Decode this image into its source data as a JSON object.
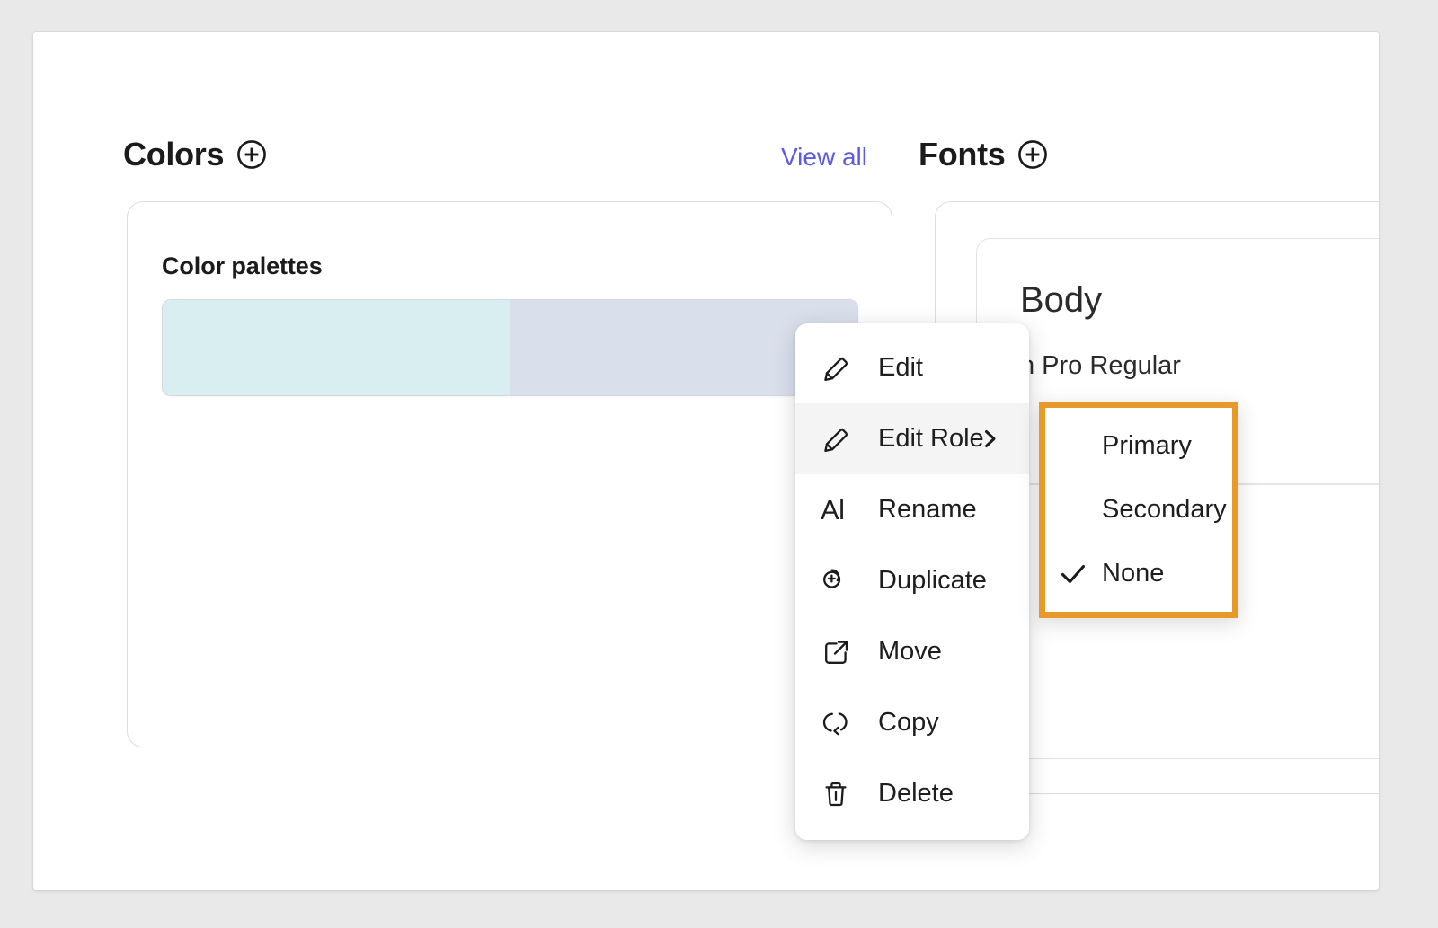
{
  "colors_section": {
    "title": "Colors",
    "add_icon": "plus-circle-icon",
    "view_all_label": "View all",
    "panel": {
      "title": "Color palettes",
      "palette": {
        "swatch_a_color": "#d9eef0",
        "swatch_b_color": "#dadfec"
      }
    }
  },
  "fonts_section": {
    "title": "Fonts",
    "add_icon": "plus-circle-icon",
    "panel": {
      "sample_name": "Body",
      "sample_family": "n Pro Regular"
    }
  },
  "context_menu": {
    "items": [
      {
        "label": "Edit",
        "icon": "pencil-icon",
        "highlighted": false,
        "has_submenu": false
      },
      {
        "label": "Edit Role",
        "icon": "pencil-icon",
        "highlighted": true,
        "has_submenu": true
      },
      {
        "label": "Rename",
        "icon": "text-rename-icon",
        "highlighted": false,
        "has_submenu": false
      },
      {
        "label": "Duplicate",
        "icon": "duplicate-icon",
        "highlighted": false,
        "has_submenu": false
      },
      {
        "label": "Move",
        "icon": "move-arrow-icon",
        "highlighted": false,
        "has_submenu": false
      },
      {
        "label": "Copy",
        "icon": "copy-icon",
        "highlighted": false,
        "has_submenu": false
      },
      {
        "label": "Delete",
        "icon": "trash-icon",
        "highlighted": false,
        "has_submenu": false
      }
    ]
  },
  "role_submenu": {
    "highlight_color": "#e9982a",
    "items": [
      {
        "label": "Primary",
        "checked": false
      },
      {
        "label": "Secondary",
        "checked": false
      },
      {
        "label": "None",
        "checked": true
      }
    ]
  }
}
